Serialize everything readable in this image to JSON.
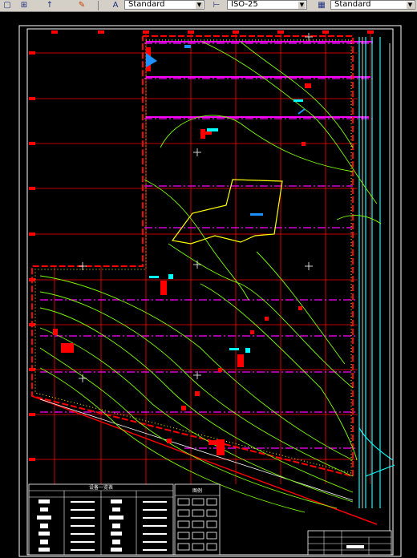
{
  "toolbar": {
    "text_style": "Standard",
    "dim_style": "ISO-25",
    "table_style": "Standard",
    "icons": [
      "new-icon",
      "layers-icon",
      "pan-icon",
      "match-prop-icon",
      "text-style-icon",
      "dim-style-icon",
      "table-style-icon"
    ]
  },
  "drawing": {
    "equipment_table_title": "设备一览表",
    "legend_title": "图例",
    "colors": {
      "background": "#000000",
      "grid": "#ff0000",
      "contour": "#7cfc00",
      "boundary": "#ff0000",
      "magenta_line": "#ff00ff",
      "cyan_line": "#00ffff",
      "pond": "#ffff00",
      "frame": "#ffffff"
    }
  }
}
